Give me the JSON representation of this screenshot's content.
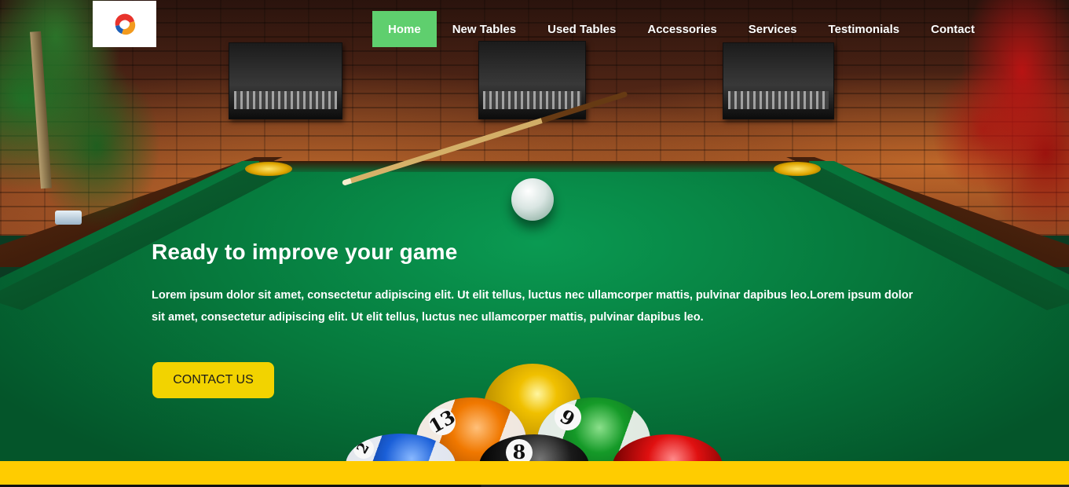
{
  "header": {
    "logo_alt": "logo",
    "nav": [
      {
        "label": "Home",
        "active": true
      },
      {
        "label": "New Tables",
        "active": false
      },
      {
        "label": "Used Tables",
        "active": false
      },
      {
        "label": "Accessories",
        "active": false
      },
      {
        "label": "Services",
        "active": false
      },
      {
        "label": "Testimonials",
        "active": false
      },
      {
        "label": "Contact",
        "active": false
      }
    ]
  },
  "hero": {
    "title": "Ready to improve your game",
    "text": "Lorem ipsum dolor sit amet, consectetur adipiscing elit. Ut elit tellus, luctus nec ullamcorper mattis, pulvinar dapibus leo.Lorem ipsum dolor sit amet, consectetur adipiscing elit. Ut elit tellus, luctus nec ullamcorper mattis, pulvinar dapibus leo.",
    "cta_label": "CONTACT US",
    "background_icon": "pool-table-scene",
    "ball_numbers": {
      "orange": "13",
      "green": "6",
      "black": "8",
      "blue": "2"
    }
  },
  "colors": {
    "nav_active": "#5fcf6e",
    "cta": "#f2d300",
    "bottom_bar": "#ffcc00",
    "text": "#ffffff"
  }
}
